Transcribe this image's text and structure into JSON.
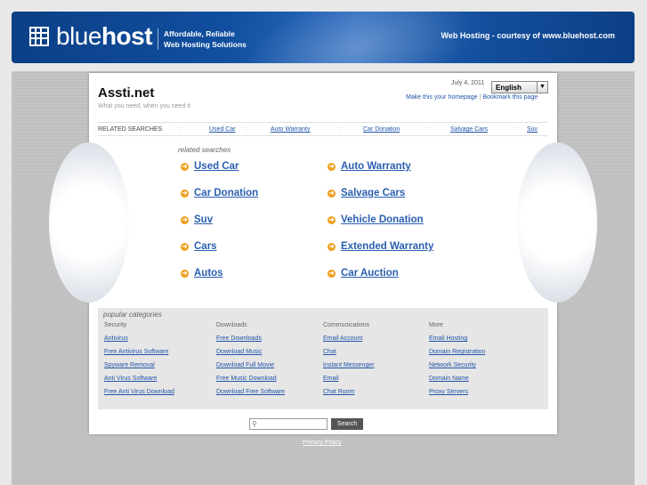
{
  "header": {
    "logo_light": "blue",
    "logo_bold": "host",
    "tagline_line1": "Affordable, Reliable",
    "tagline_line2": "Web Hosting Solutions",
    "courtesy": "Web Hosting - courtesy of www.bluehost.com"
  },
  "site": {
    "title": "Assti.net",
    "tagline": "What you need, when you need it",
    "date": "July 4, 2011",
    "language": "English",
    "make_homepage": "Make this your homepage",
    "bookmark": "Bookmark this page"
  },
  "related_bar": {
    "label": "RELATED SEARCHES",
    "links": [
      "Used Car",
      "Auto Warranty",
      "Car Donation",
      "Salvage Cars",
      "Suv"
    ]
  },
  "related": {
    "heading": "related searches",
    "left": [
      "Used Car",
      "Car Donation",
      "Suv",
      "Cars",
      "Autos"
    ],
    "right": [
      "Auto Warranty",
      "Salvage Cars",
      "Vehicle Donation",
      "Extended Warranty",
      "Car Auction"
    ]
  },
  "popular": {
    "heading": "popular categories",
    "columns": [
      {
        "title": "Security",
        "links": [
          "Antivirus",
          "Free Antivirus Software",
          "Spyware Removal",
          "Anti Virus Software",
          "Free Anti Virus Download"
        ]
      },
      {
        "title": "Downloads",
        "links": [
          "Free Downloads",
          "Download Music",
          "Download Full Movie",
          "Free Music Download",
          "Download Free Software"
        ]
      },
      {
        "title": "Communications",
        "links": [
          "Email Account",
          "Chat",
          "Instant Messenger",
          "Email",
          "Chat Room"
        ]
      },
      {
        "title": "More",
        "links": [
          "Email Hosting",
          "Domain Registration",
          "Network Security",
          "Domain Name",
          "Proxy Servers"
        ]
      }
    ]
  },
  "search": {
    "button": "Search"
  },
  "footer": {
    "privacy": "Privacy Policy"
  }
}
